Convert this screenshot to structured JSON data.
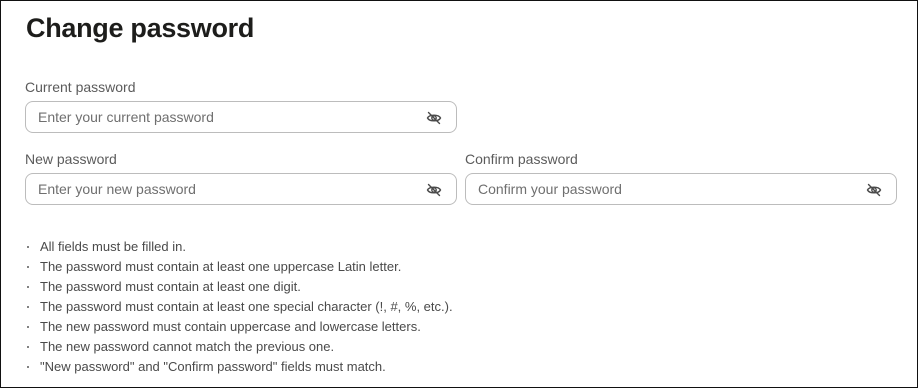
{
  "page": {
    "title": "Change password"
  },
  "form": {
    "current_password": {
      "label": "Current password",
      "placeholder": "Enter your current password",
      "value": "",
      "visibility_icon": "eye-off-icon"
    },
    "new_password": {
      "label": "New password",
      "placeholder": "Enter your new password",
      "value": "",
      "visibility_icon": "eye-off-icon"
    },
    "confirm_password": {
      "label": "Confirm password",
      "placeholder": "Confirm your password",
      "value": "",
      "visibility_icon": "eye-off-icon"
    }
  },
  "requirements": [
    "All fields must be filled in.",
    "The password must contain at least one uppercase Latin letter.",
    "The password must contain at least one digit.",
    "The password must contain at least one special character (!, #, %, etc.).",
    "The new password must contain uppercase and lowercase letters.",
    "The new password cannot match the previous one.",
    "\"New password\" and \"Confirm password\" fields must match."
  ],
  "colors": {
    "text_primary": "#1d1d1b",
    "label": "#5b5b5b",
    "input_border": "#bcbcbc",
    "placeholder": "#6f6f6f",
    "icon": "#4a4a4a"
  }
}
